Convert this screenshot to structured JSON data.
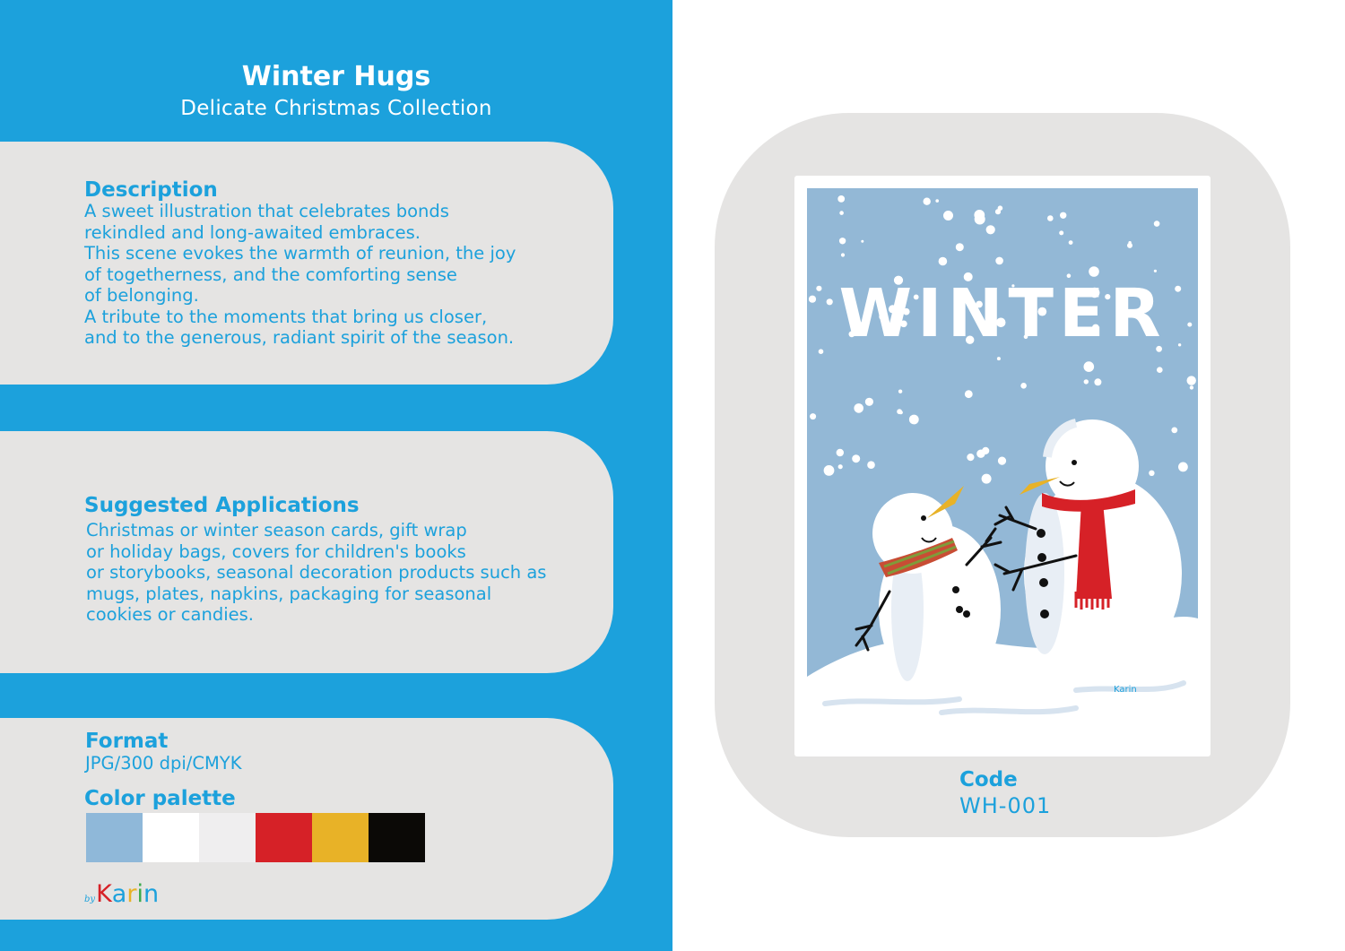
{
  "header": {
    "title": "Winter Hugs",
    "subtitle": "Delicate Christmas Collection"
  },
  "description": {
    "heading": "Description",
    "text": "A sweet illustration that celebrates bonds\nrekindled and long-awaited embraces.\nThis scene evokes the warmth of reunion, the joy\nof togetherness, and the comforting sense\nof belonging.\nA tribute to the moments that bring us closer,\nand to the generous, radiant spirit of the season."
  },
  "applications": {
    "heading": "Suggested Applications",
    "text": "Christmas or winter season cards, gift wrap\nor holiday bags, covers for children's books\nor storybooks, seasonal decoration products such as\nmugs, plates, napkins, packaging for seasonal\ncookies or candies."
  },
  "format": {
    "heading": "Format",
    "value": "JPG/300 dpi/CMYK"
  },
  "palette": {
    "heading": "Color palette",
    "colors": [
      "#8fb8d9",
      "#ffffff",
      "#efeeef",
      "#d62127",
      "#e8b227",
      "#0b0906"
    ]
  },
  "logo": {
    "by": "by",
    "letters": [
      "K",
      "a",
      "r",
      "i",
      "n"
    ],
    "letter_colors": [
      "#d62127",
      "#1ca1dc",
      "#e8b227",
      "#3aa94a",
      "#1ca1dc"
    ]
  },
  "poster": {
    "word": "WINTER",
    "signature": "Karin",
    "sky_color": "#93b8d6",
    "scarf_color": "#d62127",
    "carrot_color": "#e8b227"
  },
  "code": {
    "label": "Code",
    "value": "WH-001"
  },
  "colors": {
    "brand_blue": "#1ca1dc",
    "card_gray": "#e5e4e3"
  }
}
